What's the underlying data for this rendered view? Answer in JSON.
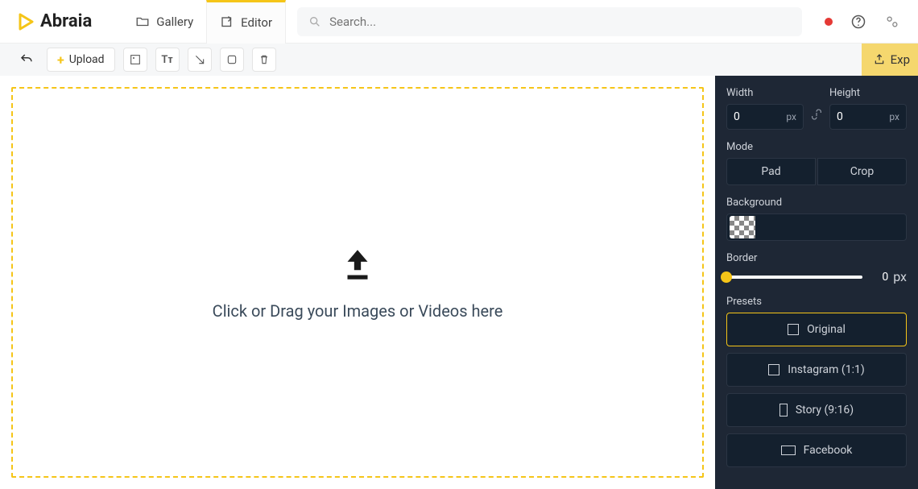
{
  "brand": "Abraia",
  "nav": {
    "gallery": "Gallery",
    "editor": "Editor"
  },
  "search": {
    "placeholder": "Search..."
  },
  "toolbar": {
    "upload": "Upload",
    "export": "Exp"
  },
  "dropzone": {
    "text": "Click or Drag your Images or Videos here"
  },
  "sidebar": {
    "width_label": "Width",
    "height_label": "Height",
    "width_value": "0",
    "height_value": "0",
    "unit": "px",
    "mode_label": "Mode",
    "mode_pad": "Pad",
    "mode_crop": "Crop",
    "background_label": "Background",
    "border_label": "Border",
    "border_value": "0",
    "presets_label": "Presets",
    "presets": {
      "original": "Original",
      "instagram": "Instagram (1:1)",
      "story": "Story (9:16)",
      "facebook": "Facebook"
    }
  }
}
